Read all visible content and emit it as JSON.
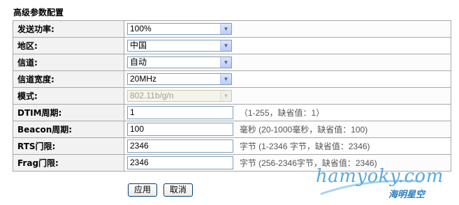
{
  "section": {
    "title": "高级参数配置"
  },
  "rows": [
    {
      "label": "发送功率:",
      "type": "select",
      "value": "100%"
    },
    {
      "label": "地区:",
      "type": "select",
      "value": "中国"
    },
    {
      "label": "信道:",
      "type": "select",
      "value": "自动"
    },
    {
      "label": "信道宽度:",
      "type": "select",
      "value": "20MHz"
    },
    {
      "label": "模式:",
      "type": "select",
      "value": "802.11b/g/n",
      "disabled": true
    },
    {
      "label": "DTIM周期:",
      "type": "input",
      "value": "1",
      "hint": "（1-255，缺省值：1）"
    },
    {
      "label": "Beacon周期:",
      "type": "input",
      "value": "100",
      "hint": "毫秒 (20-1000毫秒，缺省值：100)"
    },
    {
      "label": "RTS门限:",
      "type": "input",
      "value": "2346",
      "hint": "字节 (1-2346 字节，缺省值：2346)"
    },
    {
      "label": "Frag门限:",
      "type": "input",
      "value": "2346",
      "hint": "字节 (256-2346字节，缺省值：2346)"
    }
  ],
  "buttons": {
    "apply": "应用",
    "cancel": "取消"
  },
  "watermark": {
    "main": "hamyoky.com",
    "sub": "海明星空"
  }
}
